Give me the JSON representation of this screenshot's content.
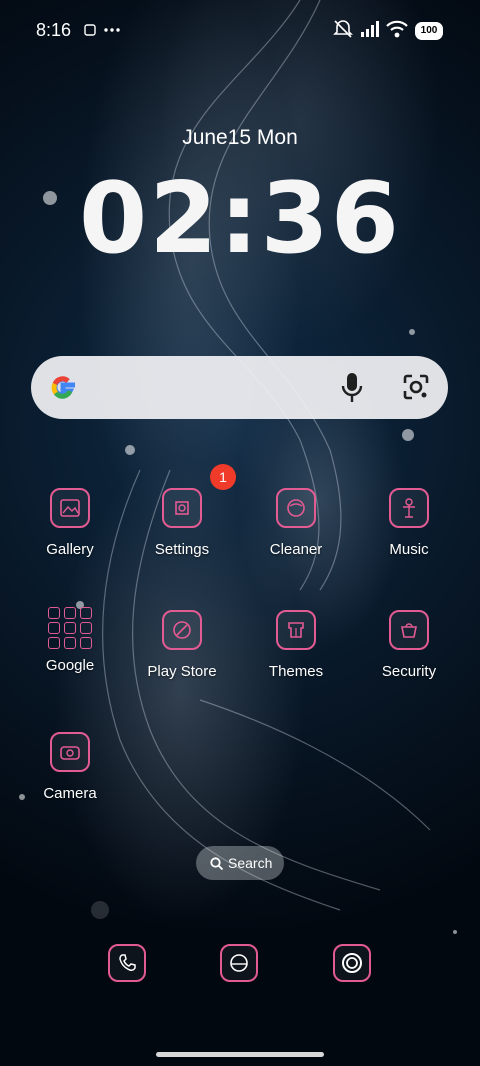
{
  "status_bar": {
    "time": "8:16",
    "battery": "100",
    "icons": [
      "notification-icon",
      "more-dots-icon",
      "mute-icon",
      "signal-icon",
      "wifi-icon",
      "battery-icon"
    ]
  },
  "lockscreen": {
    "date": "June15  Mon",
    "clock": "02:36"
  },
  "search_bar": {
    "icons": [
      "google-g-icon",
      "mic-icon",
      "google-lens-icon"
    ]
  },
  "apps": [
    {
      "label": "Gallery",
      "icon": "gallery-icon"
    },
    {
      "label": "Settings",
      "icon": "settings-icon",
      "badge": "1"
    },
    {
      "label": "Cleaner",
      "icon": "cleaner-icon"
    },
    {
      "label": "Music",
      "icon": "music-icon"
    },
    {
      "label": "Google",
      "icon": "google-folder-icon"
    },
    {
      "label": "Play Store",
      "icon": "play-store-icon"
    },
    {
      "label": "Themes",
      "icon": "themes-icon"
    },
    {
      "label": "Security",
      "icon": "security-icon"
    },
    {
      "label": "Camera",
      "icon": "camera-icon"
    }
  ],
  "search_pill": {
    "label": "Search"
  },
  "dock": [
    {
      "icon": "phone-icon"
    },
    {
      "icon": "browser-icon"
    },
    {
      "icon": "chrome-icon"
    }
  ],
  "colors": {
    "icon_border": "#e35b93",
    "badge": "#f03a2a",
    "background": "#06121f"
  }
}
